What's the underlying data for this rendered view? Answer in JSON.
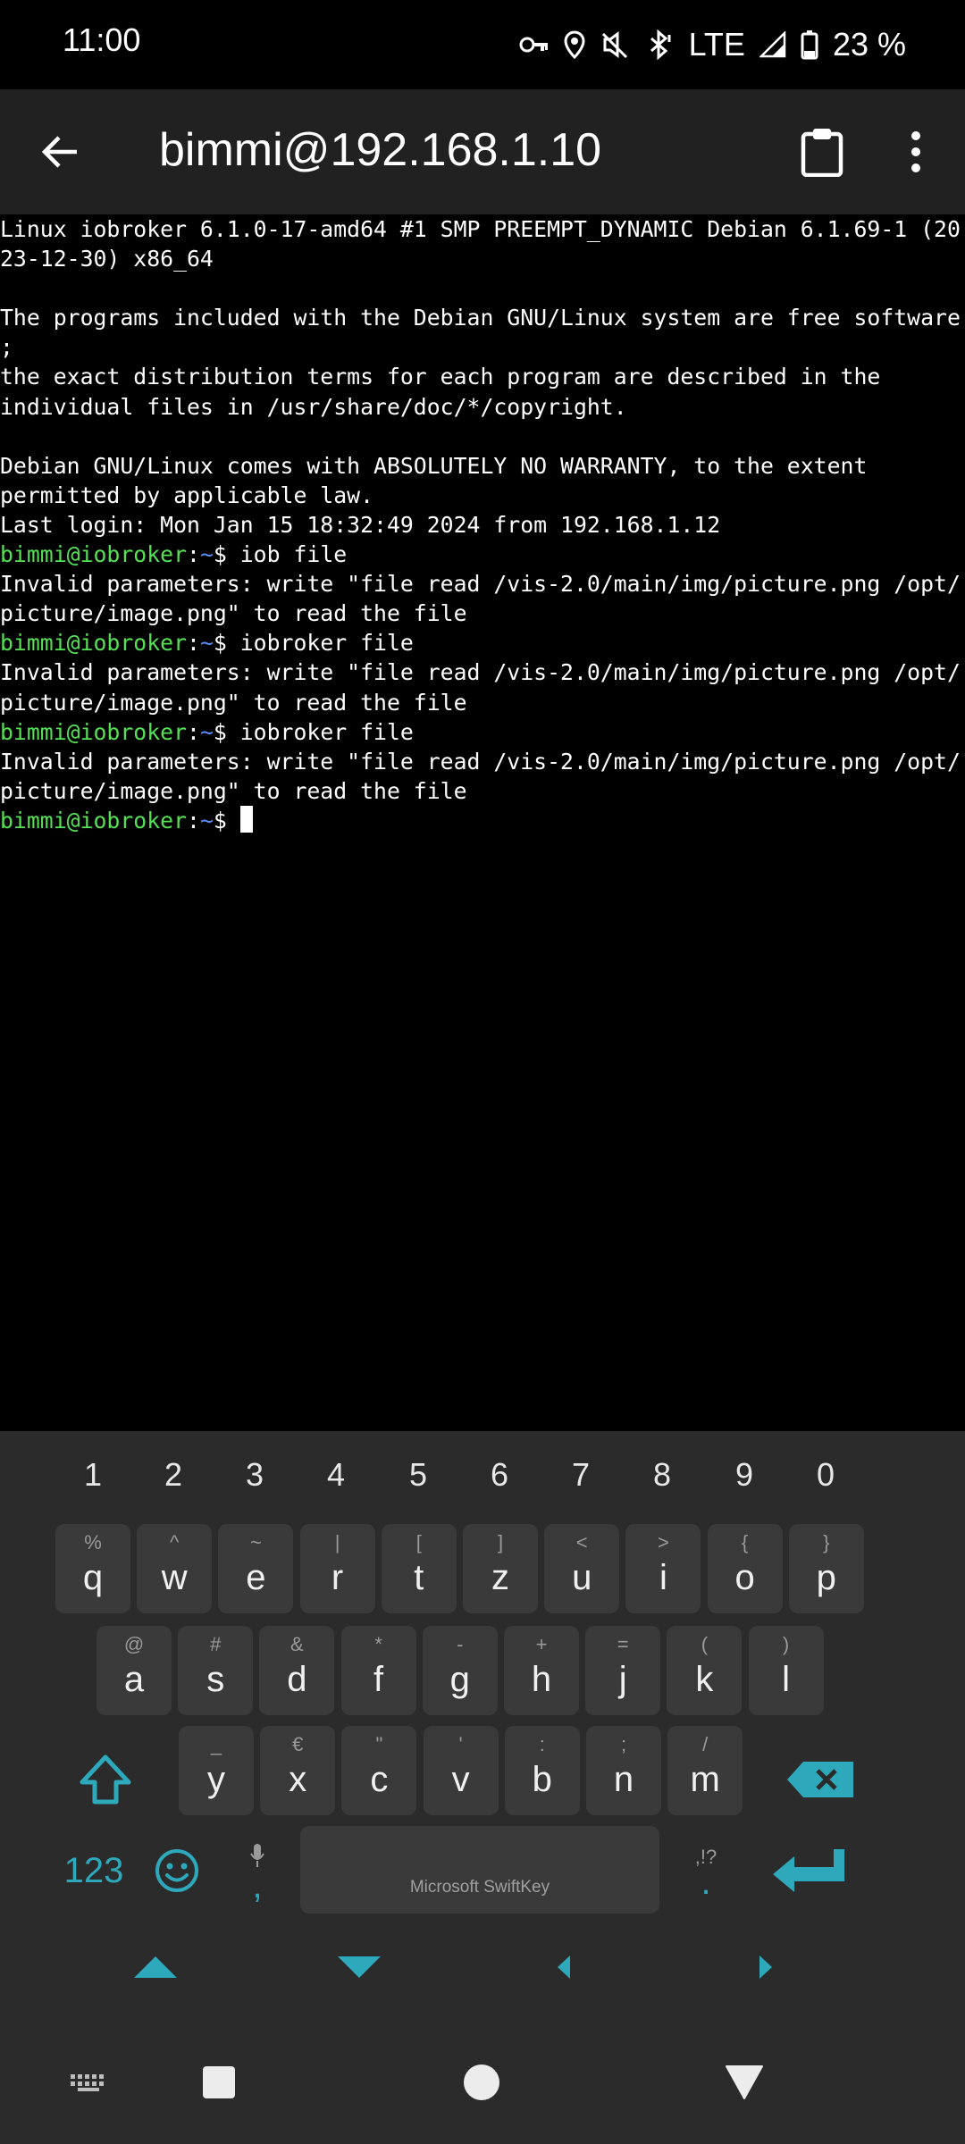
{
  "status_bar": {
    "time": "11:00",
    "network": "LTE",
    "battery": "23 %",
    "icons": [
      "vpn-key-icon",
      "location-icon",
      "vibrate-off-icon",
      "bluetooth-icon",
      "signal-icon",
      "battery-icon"
    ]
  },
  "app_bar": {
    "title": "bimmi@192.168.1.10",
    "icons": [
      "back-arrow-icon",
      "clipboard-icon",
      "more-vert-icon"
    ]
  },
  "terminal": {
    "lines": [
      {
        "type": "text",
        "text": "Linux iobroker 6.1.0-17-amd64 #1 SMP PREEMPT_DYNAMIC Debian 6.1.69-1 (20"
      },
      {
        "type": "text",
        "text": "23-12-30) x86_64"
      },
      {
        "type": "text",
        "text": ""
      },
      {
        "type": "text",
        "text": "The programs included with the Debian GNU/Linux system are free software"
      },
      {
        "type": "text",
        "text": ";"
      },
      {
        "type": "text",
        "text": "the exact distribution terms for each program are described in the"
      },
      {
        "type": "text",
        "text": "individual files in /usr/share/doc/*/copyright."
      },
      {
        "type": "text",
        "text": ""
      },
      {
        "type": "text",
        "text": "Debian GNU/Linux comes with ABSOLUTELY NO WARRANTY, to the extent"
      },
      {
        "type": "text",
        "text": "permitted by applicable law."
      },
      {
        "type": "text",
        "text": "Last login: Mon Jan 15 18:32:49 2024 from 192.168.1.12"
      },
      {
        "type": "prompt",
        "user": "bimmi@iobroker",
        "sep": ":",
        "path": "~",
        "sigil": "$ ",
        "cmd": "iob file"
      },
      {
        "type": "text",
        "text": "Invalid parameters: write \"file read /vis-2.0/main/img/picture.png /opt/"
      },
      {
        "type": "text",
        "text": "picture/image.png\" to read the file"
      },
      {
        "type": "prompt",
        "user": "bimmi@iobroker",
        "sep": ":",
        "path": "~",
        "sigil": "$ ",
        "cmd": "iobroker file"
      },
      {
        "type": "text",
        "text": "Invalid parameters: write \"file read /vis-2.0/main/img/picture.png /opt/"
      },
      {
        "type": "text",
        "text": "picture/image.png\" to read the file"
      },
      {
        "type": "prompt",
        "user": "bimmi@iobroker",
        "sep": ":",
        "path": "~",
        "sigil": "$ ",
        "cmd": "iobroker file"
      },
      {
        "type": "text",
        "text": "Invalid parameters: write \"file read /vis-2.0/main/img/picture.png /opt/"
      },
      {
        "type": "text",
        "text": "picture/image.png\" to read the file"
      },
      {
        "type": "prompt",
        "user": "bimmi@iobroker",
        "sep": ":",
        "path": "~",
        "sigil": "$ ",
        "cmd": "",
        "cursor": true
      }
    ]
  },
  "keyboard": {
    "numbers": [
      "1",
      "2",
      "3",
      "4",
      "5",
      "6",
      "7",
      "8",
      "9",
      "0"
    ],
    "row1": [
      {
        "main": "q",
        "hint": "%"
      },
      {
        "main": "w",
        "hint": "^"
      },
      {
        "main": "e",
        "hint": "~"
      },
      {
        "main": "r",
        "hint": "|"
      },
      {
        "main": "t",
        "hint": "["
      },
      {
        "main": "z",
        "hint": "]"
      },
      {
        "main": "u",
        "hint": "<"
      },
      {
        "main": "i",
        "hint": ">"
      },
      {
        "main": "o",
        "hint": "{"
      },
      {
        "main": "p",
        "hint": "}"
      }
    ],
    "row2": [
      {
        "main": "a",
        "hint": "@"
      },
      {
        "main": "s",
        "hint": "#"
      },
      {
        "main": "d",
        "hint": "&"
      },
      {
        "main": "f",
        "hint": "*"
      },
      {
        "main": "g",
        "hint": "-"
      },
      {
        "main": "h",
        "hint": "+"
      },
      {
        "main": "j",
        "hint": "="
      },
      {
        "main": "k",
        "hint": "("
      },
      {
        "main": "l",
        "hint": ")"
      }
    ],
    "row3": [
      {
        "main": "y",
        "hint": "_"
      },
      {
        "main": "x",
        "hint": "€"
      },
      {
        "main": "c",
        "hint": "\""
      },
      {
        "main": "v",
        "hint": "'"
      },
      {
        "main": "b",
        "hint": ":"
      },
      {
        "main": "n",
        "hint": ";"
      },
      {
        "main": "m",
        "hint": "/"
      }
    ],
    "symbols_key": "123",
    "comma_key": ",",
    "period_key": ".",
    "period_hint": ",!?",
    "space_label": "Microsoft SwiftKey",
    "accent_color": "#2ea8bb",
    "icons": [
      "shift-icon",
      "backspace-icon",
      "emoji-icon",
      "mic-icon",
      "enter-icon",
      "arrow-up-icon",
      "arrow-down-icon",
      "arrow-left-icon",
      "arrow-right-icon"
    ]
  },
  "nav_bar": {
    "icons": [
      "keyboard-switch-icon",
      "recents-icon",
      "home-icon",
      "back-icon"
    ]
  }
}
